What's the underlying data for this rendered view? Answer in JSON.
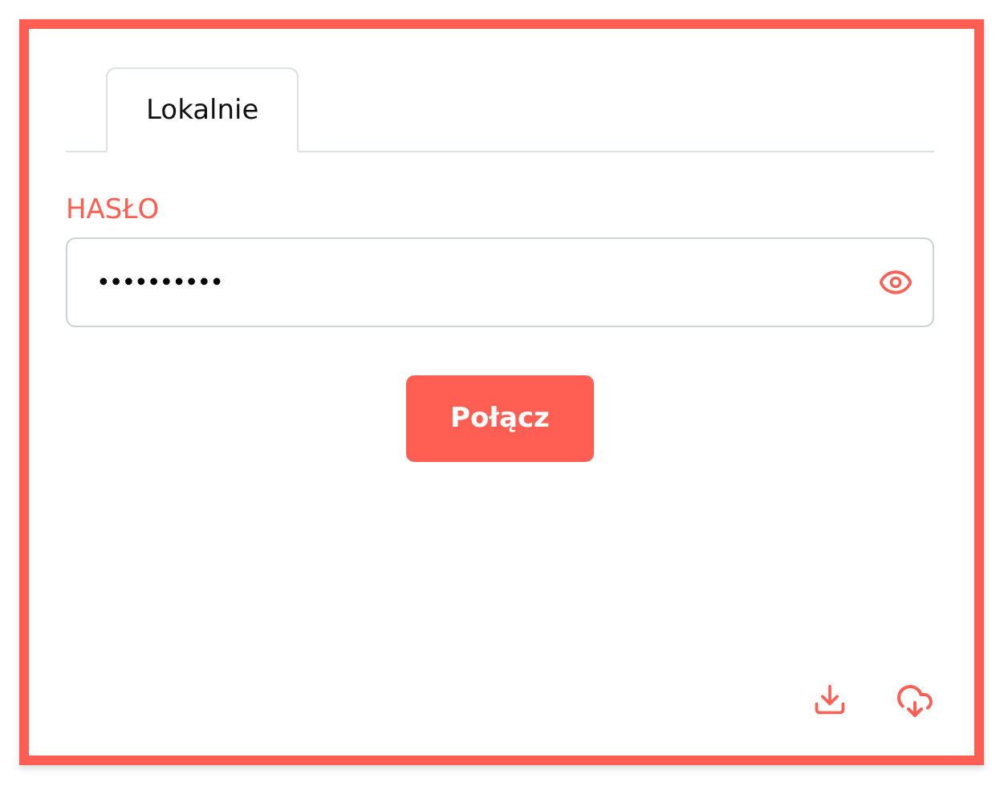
{
  "tabs": [
    {
      "label": "Lokalnie",
      "selected": true
    }
  ],
  "password": {
    "label": "HASŁO",
    "value": "••••••••••"
  },
  "connect_button": "Połącz"
}
